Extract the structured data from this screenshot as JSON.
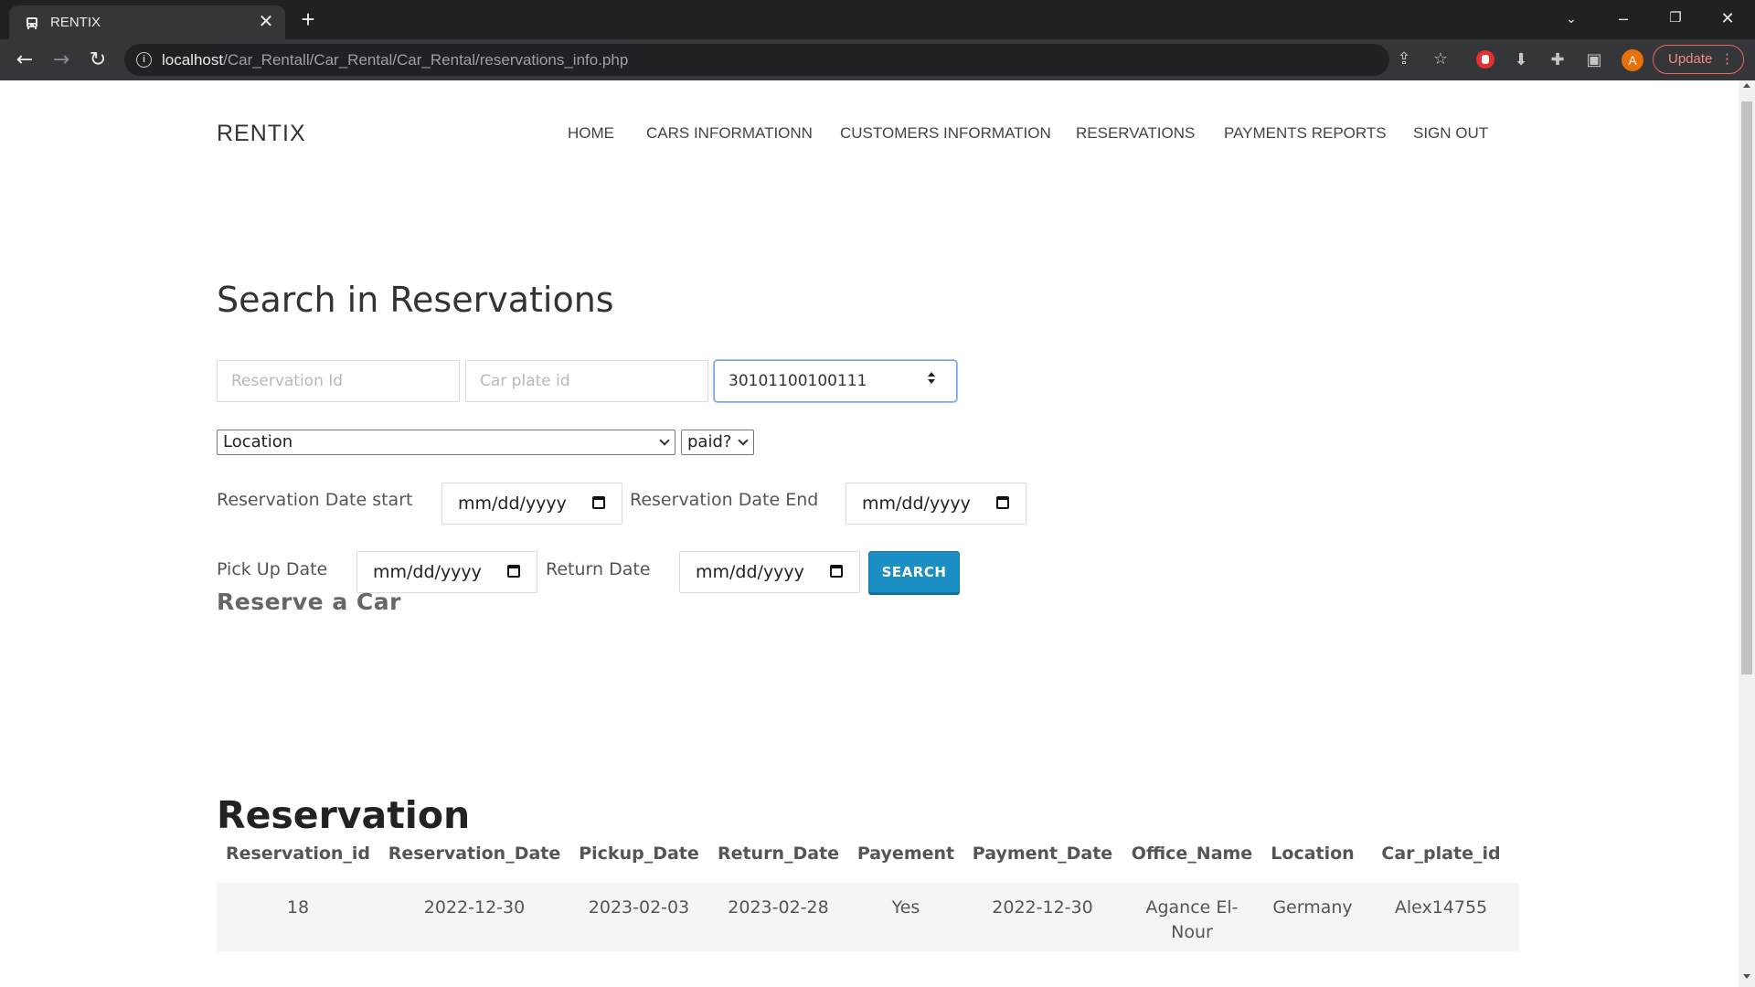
{
  "browser": {
    "tab_title": "RENTIX",
    "url_host": "localhost",
    "url_path": "/Car_Rentall/Car_Rental/Car_Rental/reservations_info.php",
    "profile_initial": "A",
    "update_label": "Update"
  },
  "site": {
    "brand": "RENTIX",
    "nav": [
      "HOME",
      "CARS INFORMATIONN",
      "CUSTOMERS INFORMATION",
      "RESERVATIONS",
      "PAYMENTS REPORTS",
      "SIGN OUT"
    ]
  },
  "search": {
    "title": "Search in Reservations",
    "reservation_id_placeholder": "Reservation Id",
    "car_plate_placeholder": "Car plate id",
    "customer_value": "30101100100111",
    "location_selected": "Location",
    "paid_selected": "paid?",
    "res_date_start_label": "Reservation Date start",
    "res_date_end_label": "Reservation Date End",
    "pickup_label": "Pick Up Date",
    "return_label": "Return Date",
    "date_placeholder": "mm/dd/yyyy",
    "button_label": "SEARCH"
  },
  "reserve": {
    "title": "Reserve a Car"
  },
  "results": {
    "title": "Reservation",
    "headers": [
      "Reservation_id",
      "Reservation_Date",
      "Pickup_Date",
      "Return_Date",
      "Payement",
      "Payment_Date",
      "Office_Name",
      "Location",
      "Car_plate_id"
    ],
    "rows": [
      [
        "18",
        "2022-12-30",
        "2023-02-03",
        "2023-02-28",
        "Yes",
        "2022-12-30",
        "Agance El-Nour",
        "Germany",
        "Alex14755"
      ]
    ]
  },
  "colors": {
    "accent": "#1b8fc4",
    "chrome_dark": "#202124",
    "chrome_toolbar": "#35363a"
  }
}
